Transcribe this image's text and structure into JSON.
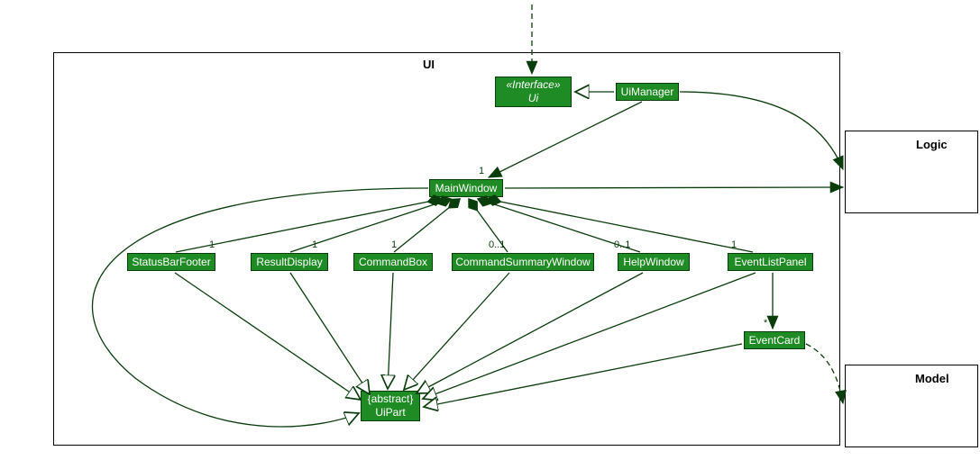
{
  "packages": {
    "ui": {
      "label": "UI"
    },
    "logic": {
      "label": "Logic"
    },
    "model": {
      "label": "Model"
    }
  },
  "classes": {
    "uiInterface": {
      "stereotype": "«Interface»",
      "name": "Ui"
    },
    "uiManager": {
      "name": "UiManager"
    },
    "mainWindow": {
      "name": "MainWindow"
    },
    "statusBarFooter": {
      "name": "StatusBarFooter"
    },
    "resultDisplay": {
      "name": "ResultDisplay"
    },
    "commandBox": {
      "name": "CommandBox"
    },
    "commandSummaryWindow": {
      "name": "CommandSummaryWindow"
    },
    "helpWindow": {
      "name": "HelpWindow"
    },
    "eventListPanel": {
      "name": "EventListPanel"
    },
    "eventCard": {
      "name": "EventCard"
    },
    "uiPart": {
      "stereotype": "{abstract}",
      "name": "UiPart"
    }
  },
  "multiplicities": {
    "mainWindow": "1",
    "statusBarFooter": "1",
    "resultDisplay": "1",
    "commandBox": "1",
    "commandSummaryWindow": "0..1",
    "helpWindow": "0..1",
    "eventListPanel": "1",
    "eventCard": "*"
  },
  "colors": {
    "classFill": "#1f8b24",
    "classBorder": "#0a3d0c",
    "line": "#0a3d0c"
  }
}
